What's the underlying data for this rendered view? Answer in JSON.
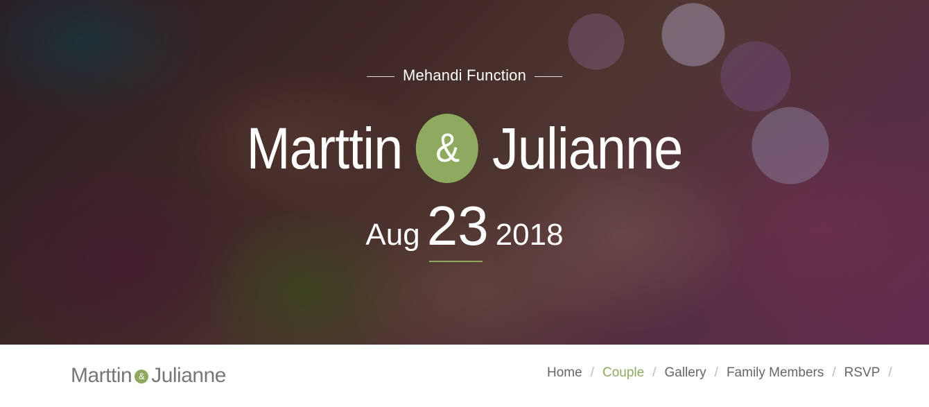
{
  "hero": {
    "subtitle": "Mehandi Function",
    "groom": "Marttin",
    "amp": "&",
    "bride": "Julianne",
    "date": {
      "month": "Aug",
      "day": "23",
      "year": "2018"
    }
  },
  "navbar": {
    "logo": {
      "first": "Marttin",
      "amp": "&",
      "second": "Julianne"
    },
    "items": [
      {
        "label": "Home",
        "active": false
      },
      {
        "label": "Couple",
        "active": true
      },
      {
        "label": "Gallery",
        "active": false
      },
      {
        "label": "Family Members",
        "active": false
      },
      {
        "label": "RSVP",
        "active": false
      }
    ],
    "separator": "/"
  },
  "colors": {
    "accent": "#8eaa5f",
    "nav_text": "#666666",
    "logo_text": "#777777"
  }
}
